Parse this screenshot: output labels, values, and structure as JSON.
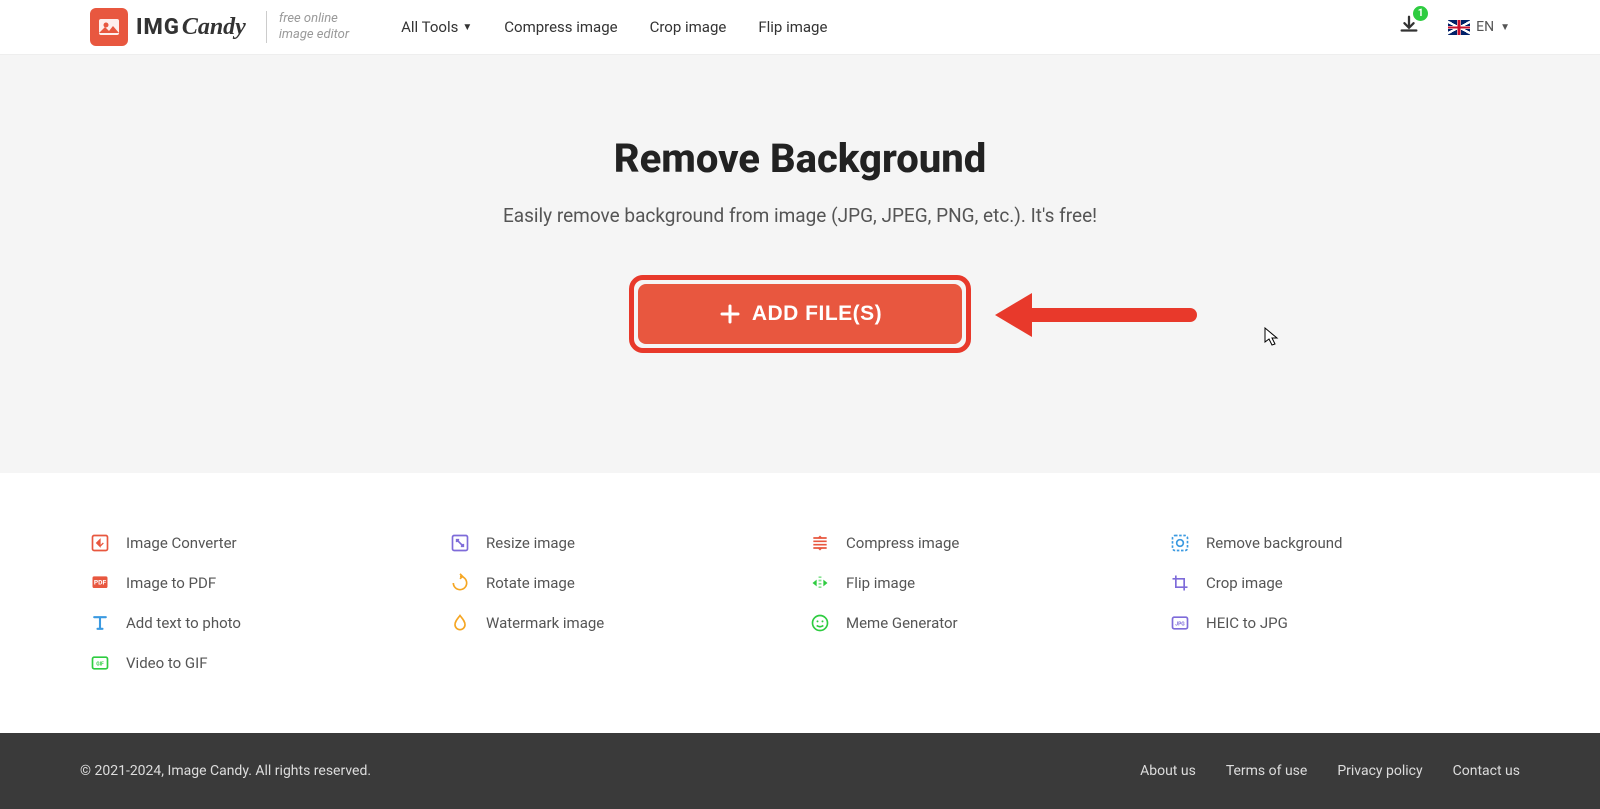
{
  "header": {
    "logo": {
      "img": "IMG",
      "candy": "Candy",
      "tagline1": "free online",
      "tagline2": "image editor"
    },
    "nav": {
      "all_tools": "All Tools",
      "compress": "Compress image",
      "crop": "Crop image",
      "flip": "Flip image"
    },
    "download_badge": "1",
    "lang": "EN"
  },
  "hero": {
    "title": "Remove Background",
    "subtitle": "Easily remove background from image (JPG, JPEG, PNG, etc.). It's free!",
    "button": "ADD FILE(S)"
  },
  "tools": [
    {
      "label": "Image Converter",
      "color": "#e8573f",
      "icon": "convert"
    },
    {
      "label": "Resize image",
      "color": "#7e6bd9",
      "icon": "resize"
    },
    {
      "label": "Compress image",
      "color": "#e8573f",
      "icon": "compress"
    },
    {
      "label": "Remove background",
      "color": "#3b9ae1",
      "icon": "removebg"
    },
    {
      "label": "Image to PDF",
      "color": "#e8573f",
      "icon": "pdf"
    },
    {
      "label": "Rotate image",
      "color": "#f5a623",
      "icon": "rotate"
    },
    {
      "label": "Flip image",
      "color": "#2ecc40",
      "icon": "flip"
    },
    {
      "label": "Crop image",
      "color": "#7e6bd9",
      "icon": "crop"
    },
    {
      "label": "Add text to photo",
      "color": "#3b9ae1",
      "icon": "text"
    },
    {
      "label": "Watermark image",
      "color": "#f5a623",
      "icon": "watermark"
    },
    {
      "label": "Meme Generator",
      "color": "#2ecc40",
      "icon": "meme"
    },
    {
      "label": "HEIC to JPG",
      "color": "#7e6bd9",
      "icon": "heic"
    },
    {
      "label": "Video to GIF",
      "color": "#2ecc40",
      "icon": "gif"
    }
  ],
  "footer": {
    "copyright": "© 2021-2024, Image Candy. All rights reserved.",
    "links": {
      "about": "About us",
      "terms": "Terms of use",
      "privacy": "Privacy policy",
      "contact": "Contact us"
    }
  }
}
